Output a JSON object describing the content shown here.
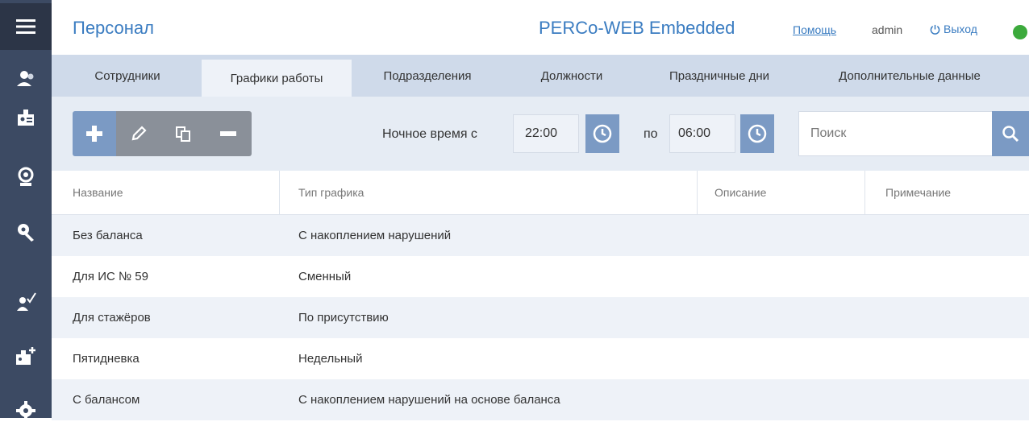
{
  "header": {
    "title": "Персонал",
    "brand": "PERCo-WEB Embedded",
    "help": "Помощь",
    "user": "admin",
    "logout": "Выход",
    "status_color": "#3caa3c"
  },
  "tabs": [
    {
      "label": "Сотрудники",
      "active": false
    },
    {
      "label": "Графики работы",
      "active": true
    },
    {
      "label": "Подразделения",
      "active": false
    },
    {
      "label": "Должности",
      "active": false
    },
    {
      "label": "Праздничные дни",
      "active": false
    },
    {
      "label": "Дополнительные данные",
      "active": false
    }
  ],
  "toolbar": {
    "buttons": [
      "plus-icon",
      "pencil-icon",
      "copy-icon",
      "minus-icon"
    ],
    "night_label": "Ночное время с",
    "night_from": "22:00",
    "to_label": "по",
    "night_to": "06:00",
    "search_placeholder": "Поиск"
  },
  "sidebar": {
    "items": [
      "menu-icon",
      "staff-icon",
      "id-card-icon",
      "globe-person-icon",
      "key-icon",
      "person-check-icon",
      "card-add-icon",
      "settings-icon"
    ]
  },
  "table": {
    "columns": [
      "Название",
      "Тип графика",
      "Описание",
      "Примечание"
    ],
    "rows": [
      [
        "Без баланса",
        "С накоплением нарушений",
        "",
        ""
      ],
      [
        "Для ИС № 59",
        "Сменный",
        "",
        ""
      ],
      [
        "Для стажёров",
        "По присутствию",
        "",
        ""
      ],
      [
        "Пятидневка",
        "Недельный",
        "",
        ""
      ],
      [
        "С балансом",
        "С накоплением нарушений на основе баланса",
        "",
        ""
      ]
    ]
  },
  "colors": {
    "accent": "#3a7cc1",
    "sidebar": "#3c4a63",
    "tabs_bg": "#cfdaea",
    "toolbar_bg": "#e6ecf4",
    "button_blue": "#7b9ac4",
    "button_gray": "#8a9099"
  }
}
